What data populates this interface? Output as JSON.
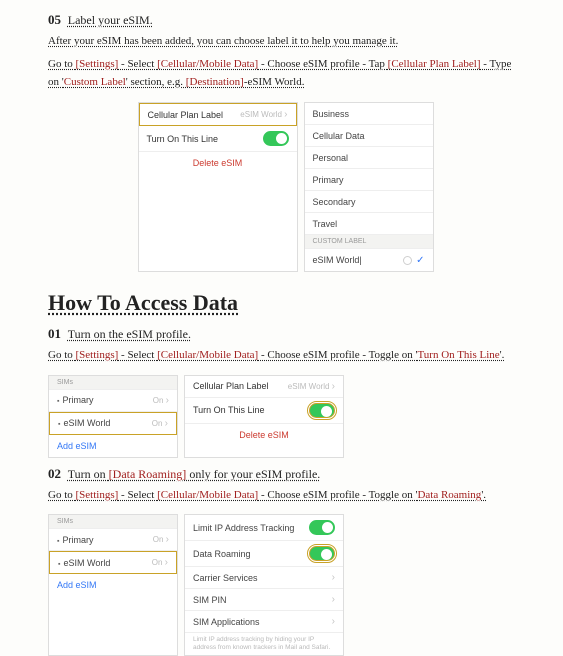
{
  "step05": {
    "num": "05",
    "title": "Label your eSIM.",
    "line1_a": "After your eSIM has been added, you can choose label it to help you manage it.",
    "line2_a": "Go to ",
    "settings": "[Settings]",
    "sep1": " - Select ",
    "cell": "[Cellular/Mobile Data]",
    "sep2": " - Choose eSIM profile - Tap ",
    "plan": "[Cellular Plan Label]",
    "sep3": " - Type on '",
    "custom": "Custom Label",
    "sep4": "' section, e.g. ",
    "dest": "[Destination]",
    "tail": "-eSIM World."
  },
  "panel05": {
    "left": {
      "row1_label": "Cellular Plan Label",
      "row1_val": "eSIM World",
      "row2_label": "Turn On This Line",
      "delete": "Delete eSIM"
    },
    "right": {
      "items": [
        "Business",
        "Cellular Data",
        "Personal",
        "Primary",
        "Secondary",
        "Travel"
      ],
      "custom_hdr": "CUSTOM LABEL",
      "custom_val": "eSIM World|"
    }
  },
  "section": "How To Access Data",
  "step01": {
    "num": "01",
    "title": "Turn on the eSIM profile.",
    "a": "Go to ",
    "settings": "[Settings]",
    "b": " - Select ",
    "cell": "[Cellular/Mobile Data]",
    "c": " - Choose eSIM profile - Toggle on '",
    "turn": "Turn On This Line",
    "d": "'."
  },
  "panel01": {
    "left": {
      "hdr": "SIMs",
      "primary": "Primary",
      "on": "On",
      "esim": "eSIM World",
      "add": "Add eSIM"
    },
    "right": {
      "row1_label": "Cellular Plan Label",
      "row1_val": "eSIM World",
      "row2_label": "Turn On This Line",
      "delete": "Delete eSIM"
    }
  },
  "step02": {
    "num": "02",
    "title_a": "Turn on ",
    "title_b": "[Data Roaming]",
    "title_c": " only for your eSIM profile.",
    "a": "Go to ",
    "settings": "[Settings]",
    "b": " - Select ",
    "cell": "[Cellular/Mobile Data]",
    "c": " - Choose eSIM profile - Toggle on '",
    "roam": "Data Roaming",
    "d": "'."
  },
  "panel02": {
    "left": {
      "hdr": "SIMs",
      "primary": "Primary",
      "on": "On",
      "esim": "eSIM World",
      "add": "Add eSIM"
    },
    "right": {
      "r1": "Limit IP Address Tracking",
      "r2": "Data Roaming",
      "r3": "Carrier Services",
      "r4": "SIM PIN",
      "r5": "SIM Applications",
      "foot": "Limit IP address tracking by hiding your IP address from known trackers in Mail and Safari."
    }
  }
}
